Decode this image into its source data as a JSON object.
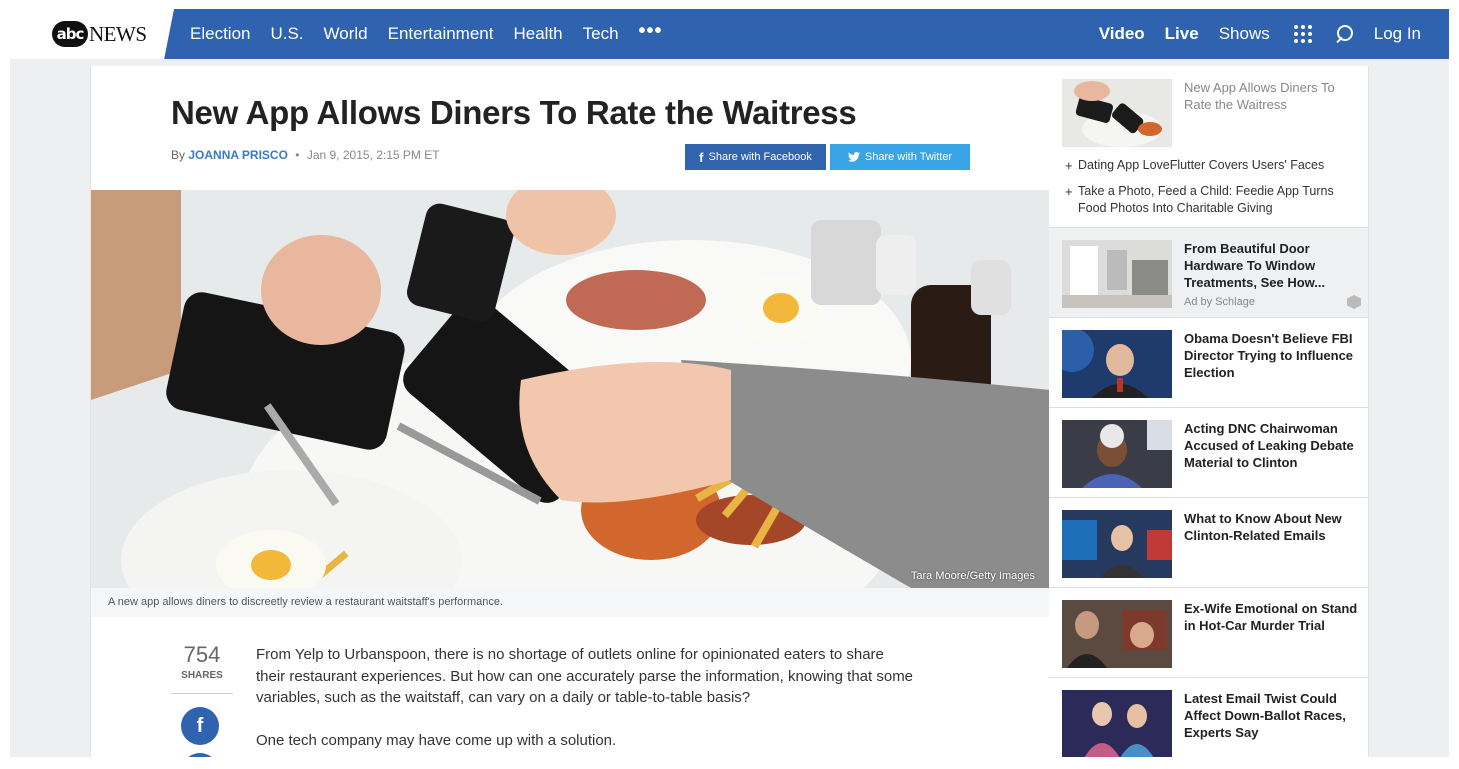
{
  "brand": {
    "logo_abc": "abc",
    "logo_news": "NEWS"
  },
  "nav": {
    "left_items": [
      "Election",
      "U.S.",
      "World",
      "Entertainment",
      "Health",
      "Tech"
    ],
    "more": "•••",
    "video": "Video",
    "live": "Live",
    "shows": "Shows",
    "login": "Log In"
  },
  "article": {
    "headline": "New App Allows Diners To Rate the Waitress",
    "by": "By",
    "author": "JOANNA PRISCO",
    "separator": "•",
    "date": "Jan 9, 2015, 2:15 PM ET",
    "share_facebook": "Share with Facebook",
    "share_twitter": "Share with Twitter",
    "image_credit": "Tara Moore/Getty Images",
    "caption": "A new app allows diners to discreetly review a restaurant waitstaff's performance.",
    "share_count": "754",
    "share_label": "SHARES",
    "paragraphs": [
      "From Yelp to Urbanspoon, there is no shortage of outlets online for opinionated eaters to share their restaurant experiences. But how can one accurately parse the information, knowing that some variables, such as the waitstaff, can vary on a daily or table-to-table basis?",
      "One tech company may have come up with a solution."
    ]
  },
  "sidebar": {
    "current_title": "New App Allows Diners To Rate the Waitress",
    "related": [
      "Dating App LoveFlutter Covers Users' Faces",
      "Take a Photo, Feed a Child: Feedie App Turns Food Photos Into Charitable Giving"
    ],
    "ad": {
      "title": "From Beautiful Door Hardware To Window Treatments, See How...",
      "by": "Ad by Schlage"
    },
    "stories": [
      "Obama Doesn't Believe FBI Director Trying to Influence Election",
      "Acting DNC Chairwoman Accused of Leaking Debate Material to Clinton",
      "What to Know About New Clinton-Related Emails",
      "Ex-Wife Emotional on Stand in Hot-Car Murder Trial",
      "Latest Email Twist Could Affect Down-Ballot Races, Experts Say"
    ]
  },
  "colors": {
    "nav_bg": "#2f63b0",
    "author": "#3a7bc8",
    "facebook": "#3263ad",
    "twitter": "#39a4e6"
  }
}
